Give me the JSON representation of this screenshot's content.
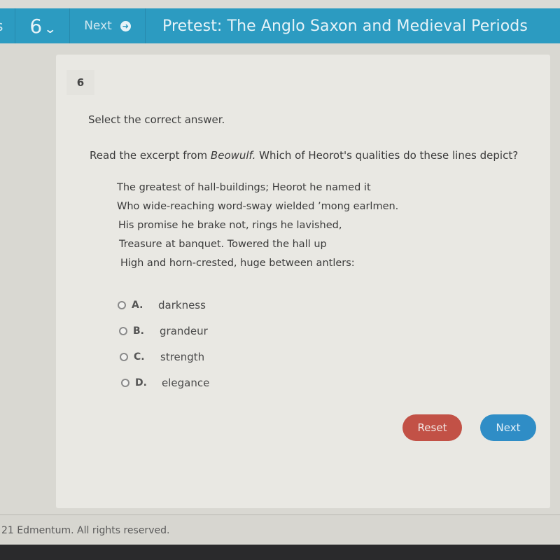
{
  "header": {
    "prev_fragment": "s",
    "question_number": "6",
    "chevron_icon": "chevron-down",
    "next_label": "Next",
    "next_icon": "arrow-right-circle",
    "title": "Pretest: The Anglo Saxon and Medieval Periods",
    "background_color": "#2c9bc1"
  },
  "question": {
    "number": "6",
    "instruction": "Select the correct answer.",
    "prompt_before": "Read the excerpt from ",
    "prompt_work": "Beowulf.",
    "prompt_after": " Which of Heorot's qualities do these lines depict?",
    "excerpt_lines": [
      "The greatest of hall-buildings; Heorot he named it",
      "Who wide-reaching word-sway wielded ’mong earlmen.",
      "His promise he brake not, rings he lavished,",
      "Treasure at banquet. Towered the hall up",
      "High and horn-crested, huge between antlers:"
    ],
    "choices": [
      {
        "letter": "A.",
        "text": "darkness",
        "selected": false
      },
      {
        "letter": "B.",
        "text": "grandeur",
        "selected": false
      },
      {
        "letter": "C.",
        "text": "strength",
        "selected": false
      },
      {
        "letter": "D.",
        "text": "elegance",
        "selected": false
      }
    ]
  },
  "actions": {
    "reset_label": "Reset",
    "next_label": "Next",
    "reset_color": "#c25146",
    "next_color": "#2f8dc6"
  },
  "footer": {
    "copyright": "21 Edmentum. All rights reserved."
  }
}
